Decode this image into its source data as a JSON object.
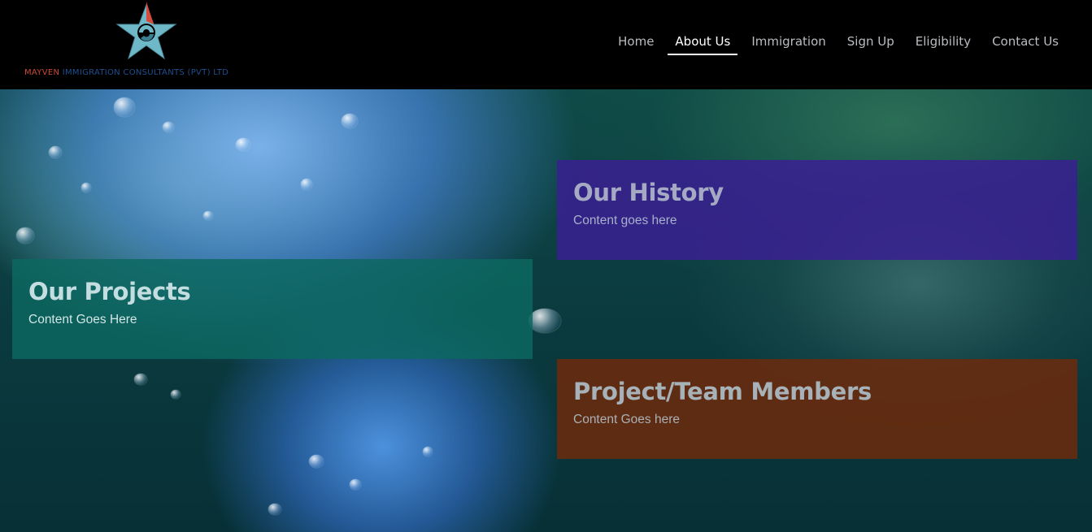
{
  "header": {
    "logo": {
      "icon": "star-logo-icon",
      "text_accent": "MAYVEN",
      "text_rest": " IMMIGRATION CONSULTANTS (PVT) LTD"
    },
    "nav": [
      {
        "label": "Home",
        "active": false
      },
      {
        "label": "About Us",
        "active": true
      },
      {
        "label": "Immigration",
        "active": false
      },
      {
        "label": "Sign Up",
        "active": false
      },
      {
        "label": "Eligibility",
        "active": false
      },
      {
        "label": "Contact Us",
        "active": false
      }
    ]
  },
  "panels": {
    "history": {
      "title": "Our History",
      "body": "Content goes here"
    },
    "projects": {
      "title": "Our Projects",
      "body": "Content Goes Here"
    },
    "team": {
      "title": "Project/Team Members",
      "body": "Content Goes here"
    }
  },
  "colors": {
    "header_bg": "#000000",
    "projects_panel": "#0c6860",
    "history_panel": "#392092",
    "team_panel": "#682b0e",
    "logo_red": "#c94a35",
    "logo_teal": "#6fb8c8"
  }
}
